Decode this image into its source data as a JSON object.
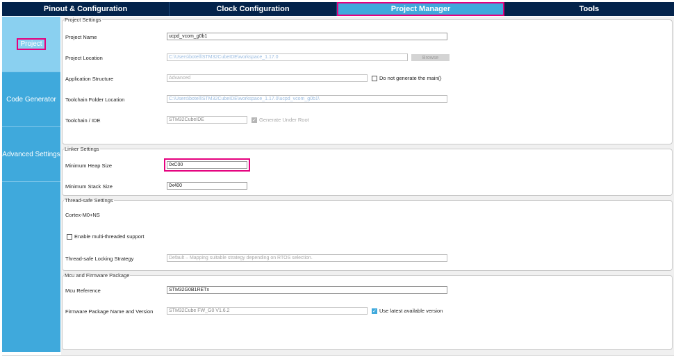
{
  "tabs": [
    {
      "label": "Pinout & Configuration"
    },
    {
      "label": "Clock Configuration"
    },
    {
      "label": "Project Manager"
    },
    {
      "label": "Tools"
    }
  ],
  "leftnav": [
    {
      "label": "Project"
    },
    {
      "label": "Code Generator"
    },
    {
      "label": "Advanced Settings"
    }
  ],
  "project_settings": {
    "legend": "Project Settings",
    "project_name_label": "Project Name",
    "project_name_value": "ucpd_vcom_g0b1",
    "project_location_label": "Project Location",
    "project_location_value": "C:\\Users\\botell\\STM32CubeIDE\\workspace_1.17.0",
    "browse_label": "Browse",
    "app_structure_label": "Application Structure",
    "app_structure_value": "Advanced",
    "do_not_generate_main_label": "Do not generate the main()",
    "toolchain_folder_label": "Toolchain Folder Location",
    "toolchain_folder_value": "C:\\Users\\botell\\STM32CubeIDE\\workspace_1.17.0\\ucpd_vcom_g0b1\\",
    "toolchain_ide_label": "Toolchain / IDE",
    "toolchain_ide_value": "STM32CubeIDE",
    "generate_under_root_label": "Generate Under Root"
  },
  "linker_settings": {
    "legend": "Linker Settings",
    "min_heap_label": "Minimum Heap Size",
    "min_heap_value": "0xC00",
    "min_stack_label": "Minimum Stack Size",
    "min_stack_value": "0x400"
  },
  "thread_safe": {
    "legend": "Thread-safe Settings",
    "core_label": "Cortex-M0+NS",
    "enable_multi_label": "Enable multi-threaded support",
    "locking_label": "Thread-safe Locking Strategy",
    "locking_value": "Default – Mapping suitable strategy depending on RTOS selection."
  },
  "mcu_firmware": {
    "legend": "Mcu and Firmware Package",
    "mcu_ref_label": "Mcu Reference",
    "mcu_ref_value": "STM32G0B1RETx",
    "fw_pkg_label": "Firmware Package Name and Version",
    "fw_pkg_value": "STM32Cube FW_G0 V1.6.2",
    "use_latest_label": "Use latest available version"
  },
  "colors": {
    "header_bg": "#03234b",
    "accent": "#3fa9dc",
    "highlight": "#e5007e"
  }
}
